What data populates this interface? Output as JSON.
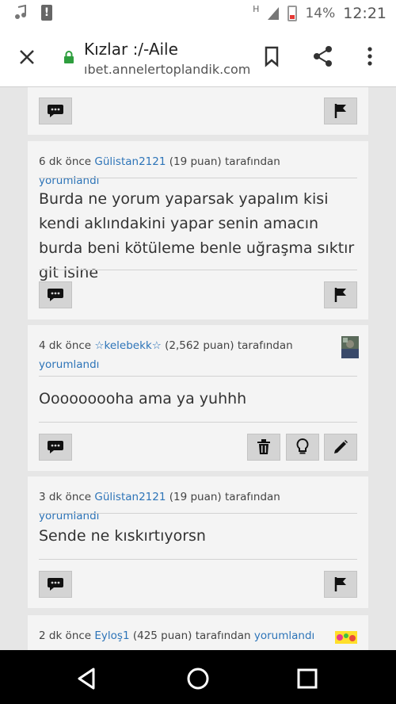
{
  "status_bar": {
    "network": "H",
    "battery": "14%",
    "time": "12:21",
    "icons": [
      "music-note-icon",
      "alert-icon",
      "signal-icon",
      "battery-icon"
    ]
  },
  "browser": {
    "title": "Kızlar :/-Aile",
    "url": "ıbet.annelertoplandik.com",
    "icons": [
      "close-icon",
      "lock-icon",
      "bookmark-icon",
      "share-icon",
      "more-icon"
    ]
  },
  "comments": [
    {
      "time": "6 dk önce",
      "user": "Gülistan2121",
      "points": "(19 puan)",
      "by": "tarafından",
      "action": "yorumlandı",
      "text": "Burda ne yorum yaparsak yapalım kisi kendi aklındakini yapar senin amacın burda beni kötüleme benle uğraşma sıktır git isine"
    },
    {
      "time": "4 dk önce",
      "user": "☆kelebekk☆",
      "points": "(2,562 puan)",
      "by": "tarafından",
      "action": "yorumlandı",
      "text": "Ooooooooha ama ya yuhhh"
    },
    {
      "time": "3 dk önce",
      "user": "Gülistan2121",
      "points": "(19 puan)",
      "by": "tarafından",
      "action": "yorumlandı",
      "text": "Sende ne kıskırtıyorsn"
    },
    {
      "time": "2 dk önce",
      "user": "Eyloş1",
      "points": "(425 puan)",
      "by": "tarafından",
      "action": "yorumlandı",
      "text": ""
    }
  ],
  "colors": {
    "link": "#2d74b8",
    "page_bg": "#e6e6e6",
    "card_bg": "#f4f4f4",
    "button_bg": "#d4d4d4",
    "lock_green": "#2e9e3e"
  }
}
